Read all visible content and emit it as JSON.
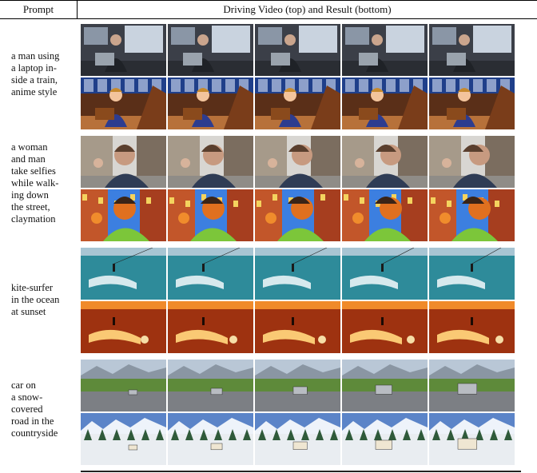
{
  "header": {
    "col1": "Prompt",
    "col2": "Driving Video (top) and Result (bottom)"
  },
  "rows": [
    {
      "prompt_lines": [
        "a man using",
        "a laptop in-",
        "side a train,",
        "anime style"
      ],
      "scene": "train",
      "frames": 5
    },
    {
      "prompt_lines": [
        "a woman",
        "and man",
        "take selfies",
        "while walk-",
        "ing down",
        "the street,",
        "claymation"
      ],
      "scene": "selfie",
      "frames": 5
    },
    {
      "prompt_lines": [
        "kite-surfer",
        "in the ocean",
        "at sunset"
      ],
      "scene": "kite",
      "frames": 5
    },
    {
      "prompt_lines": [
        "car on",
        "a snow-",
        "covered",
        "road in the",
        "countryside"
      ],
      "scene": "car",
      "frames": 5
    }
  ]
}
